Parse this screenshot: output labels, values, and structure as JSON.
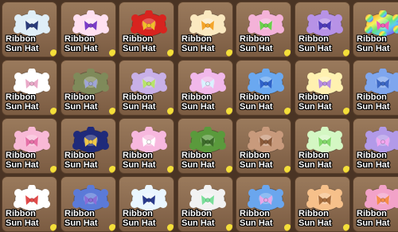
{
  "item_label_line1": "Ribbon",
  "item_label_line2": "Sun Hat",
  "items": [
    {
      "hat_color": "#dfeef7",
      "ribbon_color": "#2b3c7a"
    },
    {
      "hat_color": "#ffe0f0",
      "ribbon_color": "#7a3cc7"
    },
    {
      "hat_color": "#d8241f",
      "ribbon_color": "#f0c02a"
    },
    {
      "hat_color": "#fbe9c0",
      "ribbon_color": "#f4a52b"
    },
    {
      "hat_color": "#f4b2d8",
      "ribbon_color": "#69d14a"
    },
    {
      "hat_color": "#b792e6",
      "ribbon_color": "#4d3bb8"
    },
    {
      "hat_color": "#9fe0ea",
      "ribbon_color": "#f05cb8",
      "rainbow": true
    },
    {
      "hat_color": "#ffffff",
      "ribbon_color": "#e9a9c8"
    },
    {
      "hat_color": "#7f8a5a",
      "ribbon_color": "#9fa5d6"
    },
    {
      "hat_color": "#c8b0e8",
      "ribbon_color": "#b8e46a"
    },
    {
      "hat_color": "#f1b8ea",
      "ribbon_color": "#d9f2ff"
    },
    {
      "hat_color": "#6aa8f0",
      "ribbon_color": "#2f62c9"
    },
    {
      "hat_color": "#fff1b0",
      "ribbon_color": "#b78cdf"
    },
    {
      "hat_color": "#7fa6ee",
      "ribbon_color": "#3c67c4"
    },
    {
      "hat_color": "#f8b9d6",
      "ribbon_color": "#e66fa6"
    },
    {
      "hat_color": "#1f2a7a",
      "ribbon_color": "#f0c84a"
    },
    {
      "hat_color": "#f7b8de",
      "ribbon_color": "#ffffff"
    },
    {
      "hat_color": "#5a9a3c",
      "ribbon_color": "#3d6b2a"
    },
    {
      "hat_color": "#c89a7c",
      "ribbon_color": "#8a5a3a"
    },
    {
      "hat_color": "#d4f7c3",
      "ribbon_color": "#83d86a"
    },
    {
      "hat_color": "#b29ae8",
      "ribbon_color": "#f2a6ef"
    },
    {
      "hat_color": "#ffffff",
      "ribbon_color": "#e14a4a"
    },
    {
      "hat_color": "#5b7ad8",
      "ribbon_color": "#8a6cd6"
    },
    {
      "hat_color": "#eaf6ff",
      "ribbon_color": "#2a3b8c"
    },
    {
      "hat_color": "#f2f2f2",
      "ribbon_color": "#7adf9a"
    },
    {
      "hat_color": "#6aa6ee",
      "ribbon_color": "#e7a6e8"
    },
    {
      "hat_color": "#f6c08a",
      "ribbon_color": "#a56c3c"
    },
    {
      "hat_color": "#f2a2c8",
      "ribbon_color": "#f58c4a"
    }
  ]
}
